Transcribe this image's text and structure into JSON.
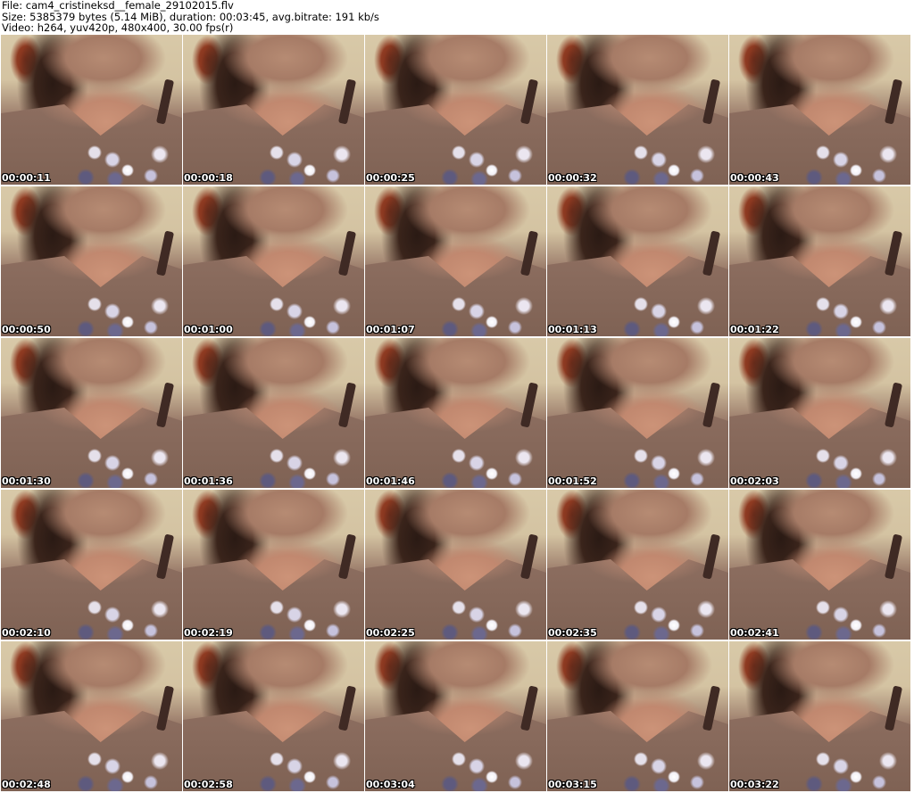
{
  "header": {
    "file_line": "File: cam4_cristineksd__female_29102015.flv",
    "size_line": "Size: 5385379 bytes (5.14 MiB), duration: 00:03:45, avg.bitrate: 191 kb/s",
    "video_line": "Video: h264, yuv420p, 480x400, 30.00 fps(r)"
  },
  "thumbnails": [
    {
      "timestamp": "00:00:11"
    },
    {
      "timestamp": "00:00:18"
    },
    {
      "timestamp": "00:00:25"
    },
    {
      "timestamp": "00:00:32"
    },
    {
      "timestamp": "00:00:43"
    },
    {
      "timestamp": "00:00:50"
    },
    {
      "timestamp": "00:01:00"
    },
    {
      "timestamp": "00:01:07"
    },
    {
      "timestamp": "00:01:13"
    },
    {
      "timestamp": "00:01:22"
    },
    {
      "timestamp": "00:01:30"
    },
    {
      "timestamp": "00:01:36"
    },
    {
      "timestamp": "00:01:46"
    },
    {
      "timestamp": "00:01:52"
    },
    {
      "timestamp": "00:02:03"
    },
    {
      "timestamp": "00:02:10"
    },
    {
      "timestamp": "00:02:19"
    },
    {
      "timestamp": "00:02:25"
    },
    {
      "timestamp": "00:02:35"
    },
    {
      "timestamp": "00:02:41"
    },
    {
      "timestamp": "00:02:48"
    },
    {
      "timestamp": "00:02:58"
    },
    {
      "timestamp": "00:03:04"
    },
    {
      "timestamp": "00:03:15"
    },
    {
      "timestamp": "00:03:22"
    }
  ]
}
